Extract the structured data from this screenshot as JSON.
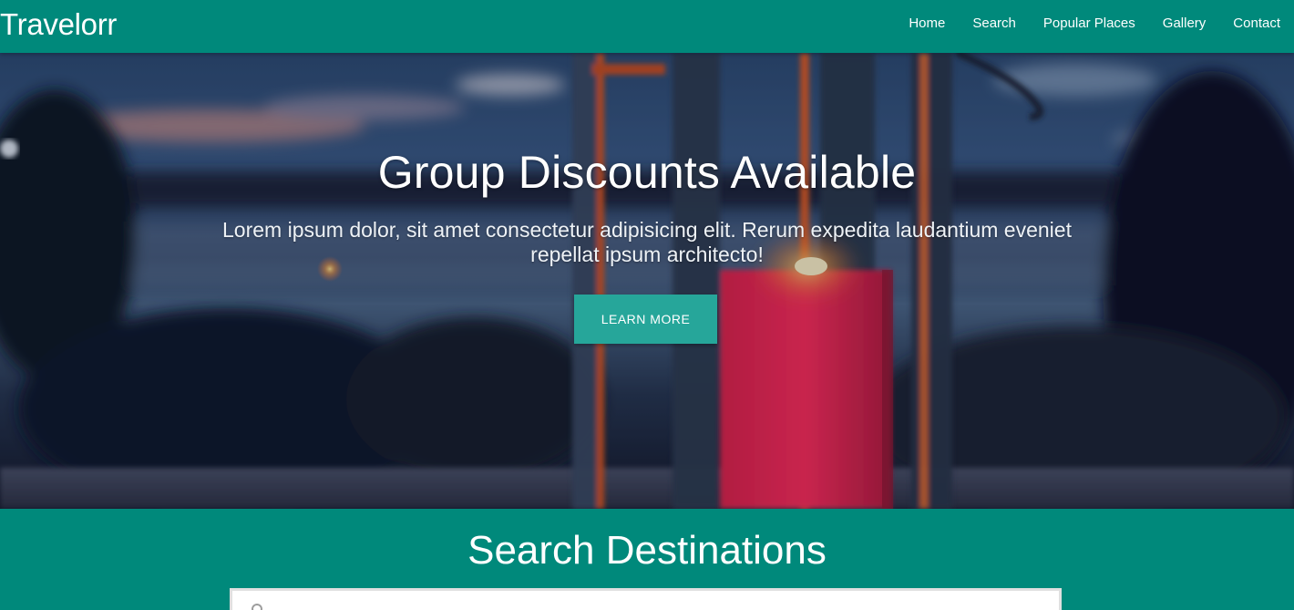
{
  "nav": {
    "brand": "Travelorr",
    "links": [
      "Home",
      "Search",
      "Popular Places",
      "Gallery",
      "Contact"
    ]
  },
  "hero": {
    "title": "Group Discounts Available",
    "text": "Lorem ipsum dolor, sit amet consectetur adipisicing elit. Rerum expedita laudantium eveniet repellat ipsum architecto!",
    "button": "LEARN MORE"
  },
  "search": {
    "title": "Search Destinations"
  },
  "colors": {
    "primary": "#00897b",
    "button": "#26a69a"
  }
}
